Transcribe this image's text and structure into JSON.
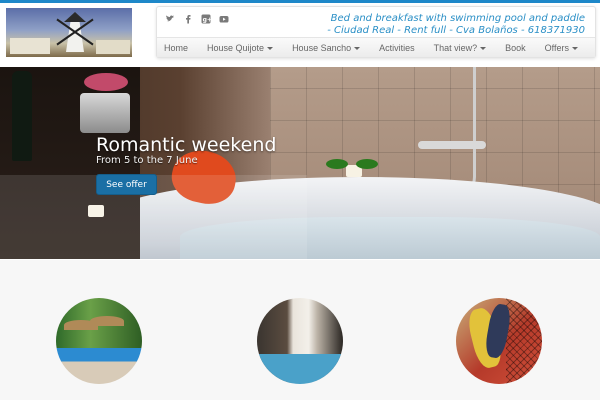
{
  "header": {
    "tagline": "Bed and breakfast with swimming pool and paddle - Ciudad Real - Rent full - Cva Bolaños - 618371930",
    "social": [
      "twitter-icon",
      "facebook-icon",
      "google-plus-icon",
      "youtube-icon"
    ],
    "nav": [
      {
        "label": "Home",
        "dropdown": false
      },
      {
        "label": "House Quijote",
        "dropdown": true
      },
      {
        "label": "House Sancho",
        "dropdown": true
      },
      {
        "label": "Activities",
        "dropdown": false
      },
      {
        "label": "That view?",
        "dropdown": true
      },
      {
        "label": "Book",
        "dropdown": false
      },
      {
        "label": "Offers",
        "dropdown": true
      }
    ]
  },
  "hero": {
    "title": "Romantic weekend",
    "subtitle": "From 5 to the 7 June",
    "button_label": "See offer"
  },
  "colors": {
    "accent": "#1e88c9",
    "tagline": "#2a8fc6",
    "button": "#1a6fa5"
  }
}
